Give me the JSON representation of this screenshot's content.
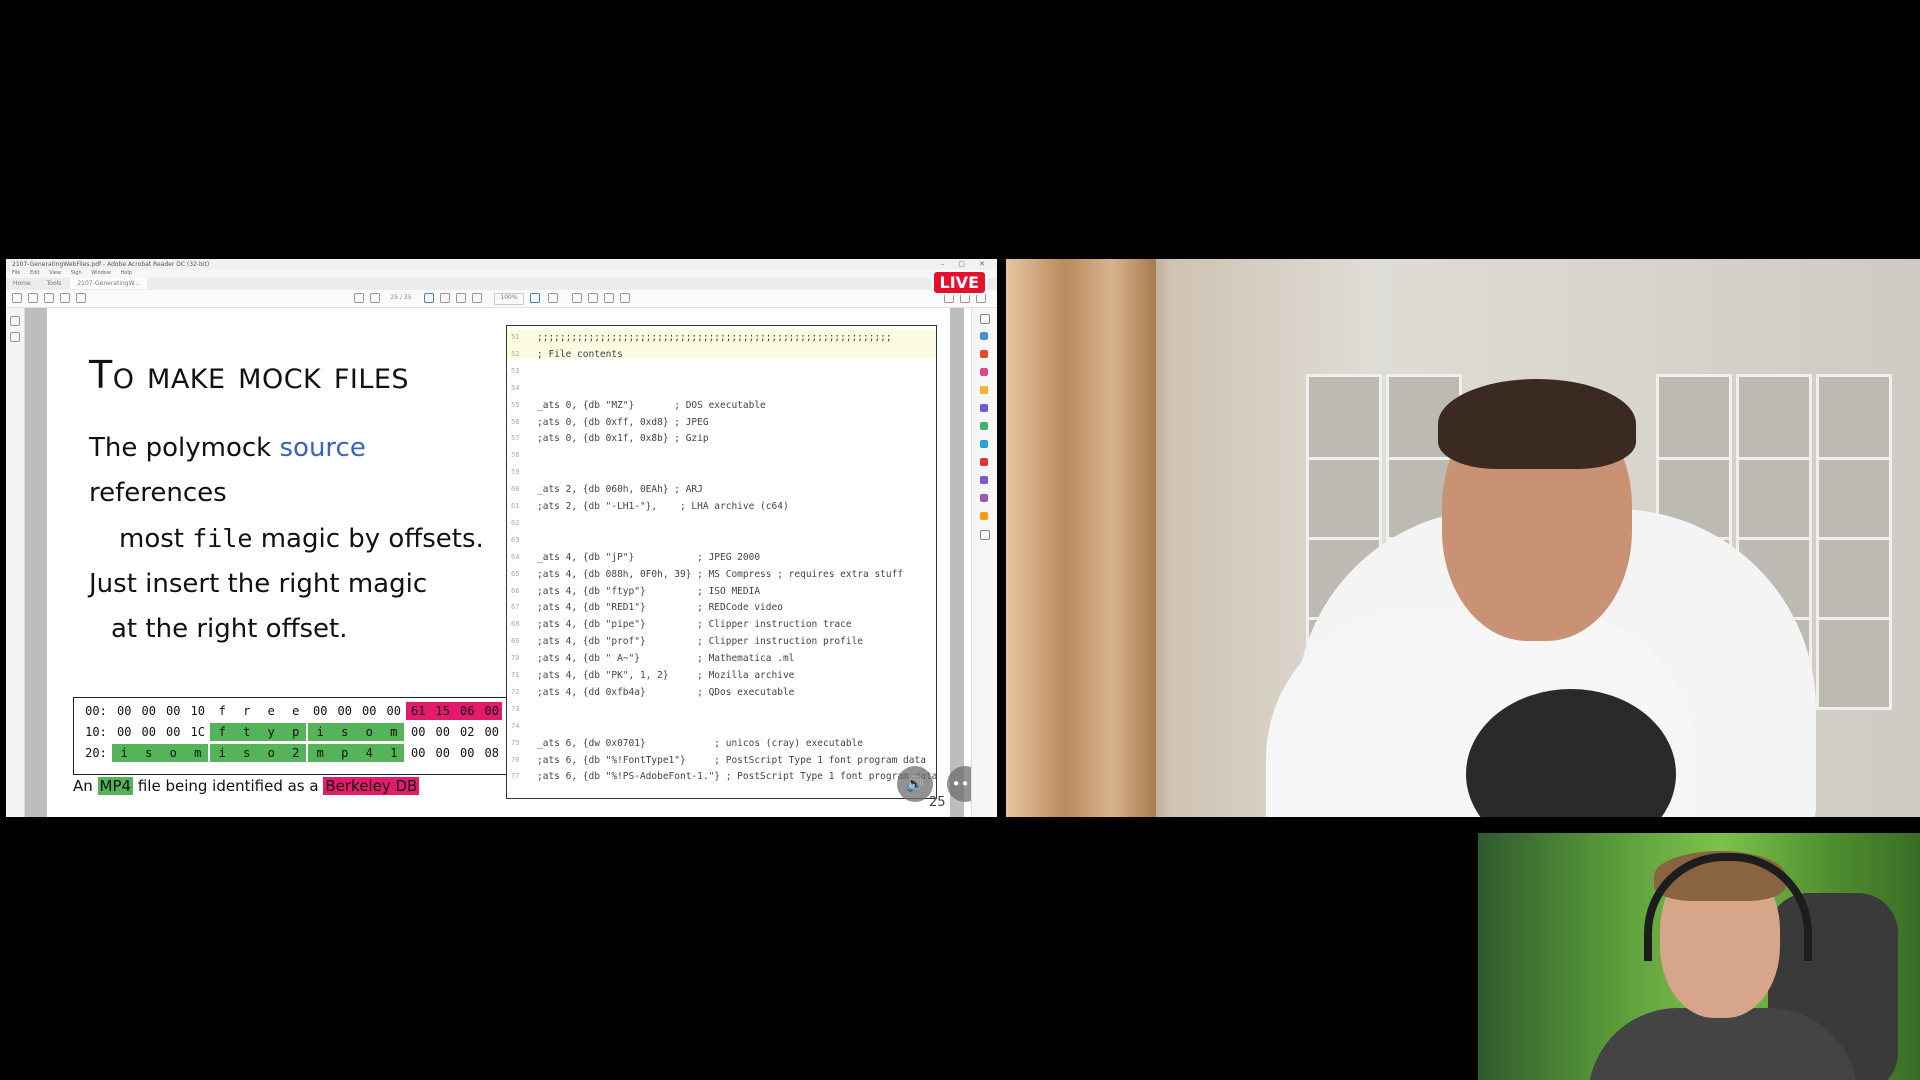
{
  "viewer": {
    "window_title": "2107-GeneratingWebFiles.pdf - Adobe Acrobat Reader DC (32-bit)",
    "menu": [
      "File",
      "Edit",
      "View",
      "Sign",
      "Window",
      "Help"
    ],
    "tabs": [
      "Home",
      "Tools",
      "2107-GeneratingW..."
    ],
    "page_indicator": "25 / 35",
    "zoom": "100%",
    "live_badge": "LIVE",
    "page_number": "25"
  },
  "slide": {
    "title": "To make mock files",
    "body": {
      "line1_a": "The polymock ",
      "line1_link": "source",
      "line1_b": " references",
      "line2_a": "most ",
      "line2_mono": "file",
      "line2_b": " magic by offsets.",
      "line3": "Just insert the right magic",
      "line4": "at the right offset."
    },
    "hex_rows": [
      {
        "offset": "00:",
        "cells": [
          "00",
          "00",
          "00",
          "10",
          "f",
          "r",
          "e",
          "e",
          "00",
          "00",
          "00",
          "00",
          "61",
          "15",
          "06",
          "00"
        ]
      },
      {
        "offset": "10:",
        "cells": [
          "00",
          "00",
          "00",
          "1C",
          "f",
          "t",
          "y",
          "p",
          "i",
          "s",
          "o",
          "m",
          "00",
          "00",
          "02",
          "00"
        ]
      },
      {
        "offset": "20:",
        "cells": [
          "i",
          "s",
          "o",
          "m",
          "i",
          "s",
          "o",
          "2",
          "m",
          "p",
          "4",
          "1",
          "00",
          "00",
          "00",
          "08"
        ]
      }
    ],
    "caption": {
      "prefix": "An ",
      "mp4": "MP4",
      "middle": " file being identified as a ",
      "berkeley": "Berkeley DB"
    },
    "highlight_colors": {
      "green": "#55b35a",
      "magenta": "#e21b6c",
      "link": "#3a64b8"
    }
  },
  "code": {
    "lines": [
      {
        "n": "51",
        "t": ";;;;;;;;;;;;;;;;;;;;;;;;;;;;;;;;;;;;;;;;;;;;;;;;;;;;;;;;;;;;;;"
      },
      {
        "n": "52",
        "t": "; File contents"
      },
      {
        "n": "53",
        "t": ""
      },
      {
        "n": "54",
        "t": ""
      },
      {
        "n": "55",
        "t": "_ats 0, {db \"MZ\"}       ; DOS executable"
      },
      {
        "n": "56",
        "t": ";ats 0, {db 0xff, 0xd8} ; JPEG"
      },
      {
        "n": "57",
        "t": ";ats 0, {db 0x1f, 0x8b} ; Gzip"
      },
      {
        "n": "58",
        "t": ""
      },
      {
        "n": "59",
        "t": ""
      },
      {
        "n": "60",
        "t": "_ats 2, {db 060h, 0EAh} ; ARJ"
      },
      {
        "n": "61",
        "t": ";ats 2, {db \"-LH1-\"},    ; LHA archive (c64)"
      },
      {
        "n": "62",
        "t": ""
      },
      {
        "n": "63",
        "t": ""
      },
      {
        "n": "64",
        "t": "_ats 4, {db \"jP\"}           ; JPEG 2000"
      },
      {
        "n": "65",
        "t": ";ats 4, {db 088h, 0F0h, 39} ; MS Compress ; requires extra stuff"
      },
      {
        "n": "66",
        "t": ";ats 4, {db \"ftyp\"}         ; ISO MEDIA"
      },
      {
        "n": "67",
        "t": ";ats 4, {db \"RED1\"}         ; REDCode video"
      },
      {
        "n": "68",
        "t": ";ats 4, {db \"pipe\"}         ; Clipper instruction trace"
      },
      {
        "n": "69",
        "t": ";ats 4, {db \"prof\"}         ; Clipper instruction profile"
      },
      {
        "n": "70",
        "t": ";ats 4, {db \" A~\"}          ; Mathematica .ml"
      },
      {
        "n": "71",
        "t": ";ats 4, {db \"PK\", 1, 2}     ; Mozilla archive"
      },
      {
        "n": "72",
        "t": ";ats 4, {dd 0xfb4a}         ; QDos executable"
      },
      {
        "n": "73",
        "t": ""
      },
      {
        "n": "74",
        "t": ""
      },
      {
        "n": "75",
        "t": "_ats 6, {dw 0x0701}            ; unicos (cray) executable"
      },
      {
        "n": "76",
        "t": ";ats 6, {db \"%!FontType1\"}     ; PostScript Type 1 font program data"
      },
      {
        "n": "77",
        "t": ";ats 6, {db \"%!PS-AdobeFont-1.\"} ; PostScript Type 1 font program data"
      }
    ]
  },
  "controls": {
    "more": "•••",
    "audio": "🔊"
  }
}
